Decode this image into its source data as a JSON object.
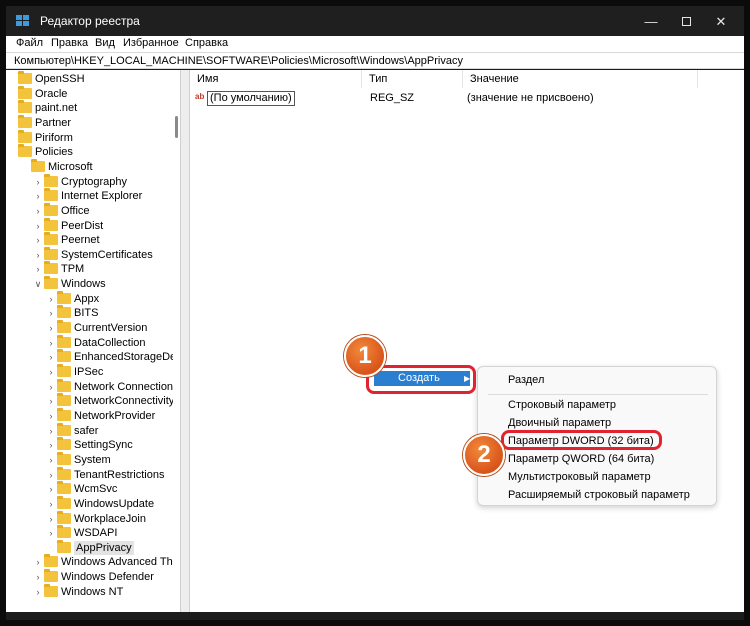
{
  "window": {
    "title": "Редактор реестра",
    "controls": {
      "minimize": "—",
      "close": "✕"
    }
  },
  "menu": [
    {
      "label": "Файл"
    },
    {
      "label": "Правка"
    },
    {
      "label": "Вид"
    },
    {
      "label": "Избранное"
    },
    {
      "label": "Справка"
    }
  ],
  "address": "Компьютер\\HKEY_LOCAL_MACHINE\\SOFTWARE\\Policies\\Microsoft\\Windows\\AppPrivacy",
  "tree": [
    {
      "label": "OpenSSH",
      "chevron": ""
    },
    {
      "label": "Oracle",
      "chevron": ""
    },
    {
      "label": "paint.net",
      "chevron": ""
    },
    {
      "label": "Partner",
      "chevron": ""
    },
    {
      "label": "Piriform",
      "chevron": ""
    },
    {
      "label": "Policies",
      "chevron": ""
    },
    {
      "label": "Microsoft",
      "chevron": ""
    },
    {
      "label": "Cryptography",
      "chevron": ">"
    },
    {
      "label": "Internet Explorer",
      "chevron": ">"
    },
    {
      "label": "Office",
      "chevron": ">"
    },
    {
      "label": "PeerDist",
      "chevron": ">"
    },
    {
      "label": "Peernet",
      "chevron": ">"
    },
    {
      "label": "SystemCertificates",
      "chevron": ">"
    },
    {
      "label": "TPM",
      "chevron": ">"
    },
    {
      "label": "Windows",
      "chevron": "v"
    },
    {
      "label": "Appx",
      "chevron": ">"
    },
    {
      "label": "BITS",
      "chevron": ">"
    },
    {
      "label": "CurrentVersion",
      "chevron": ">"
    },
    {
      "label": "DataCollection",
      "chevron": ">"
    },
    {
      "label": "EnhancedStorageDevices",
      "chevron": ">"
    },
    {
      "label": "IPSec",
      "chevron": ">"
    },
    {
      "label": "Network Connections",
      "chevron": ">"
    },
    {
      "label": "NetworkConnectivityStatu",
      "chevron": ">"
    },
    {
      "label": "NetworkProvider",
      "chevron": ">"
    },
    {
      "label": "safer",
      "chevron": ">"
    },
    {
      "label": "SettingSync",
      "chevron": ">"
    },
    {
      "label": "System",
      "chevron": ">"
    },
    {
      "label": "TenantRestrictions",
      "chevron": ">"
    },
    {
      "label": "WcmSvc",
      "chevron": ">"
    },
    {
      "label": "WindowsUpdate",
      "chevron": ">"
    },
    {
      "label": "WorkplaceJoin",
      "chevron": ">"
    },
    {
      "label": "WSDAPI",
      "chevron": ">"
    },
    {
      "label": "AppPrivacy",
      "chevron": ""
    },
    {
      "label": "Windows Advanced Threat P",
      "chevron": ">"
    },
    {
      "label": "Windows Defender",
      "chevron": ">"
    },
    {
      "label": "Windows NT",
      "chevron": ">"
    }
  ],
  "list": {
    "columns": {
      "name": "Имя",
      "type": "Тип",
      "value": "Значение"
    },
    "rows": [
      {
        "icon": "ab",
        "name": "(По умолчанию)",
        "type": "REG_SZ",
        "value": "(значение не присвоено)"
      }
    ]
  },
  "context_menu": {
    "create": "Создать",
    "submenu": [
      "Раздел",
      "Строковый параметр",
      "Двоичный параметр",
      "Параметр DWORD (32 бита)",
      "Параметр QWORD (64 бита)",
      "Мультистроковый параметр",
      "Расширяемый строковый параметр"
    ]
  },
  "annotations": {
    "step1": "1",
    "step2": "2"
  },
  "colors": {
    "highlight": "#2a7fd1",
    "annotation": "#e1232f",
    "badge": "#e0641f",
    "folder": "#f3c33b"
  }
}
